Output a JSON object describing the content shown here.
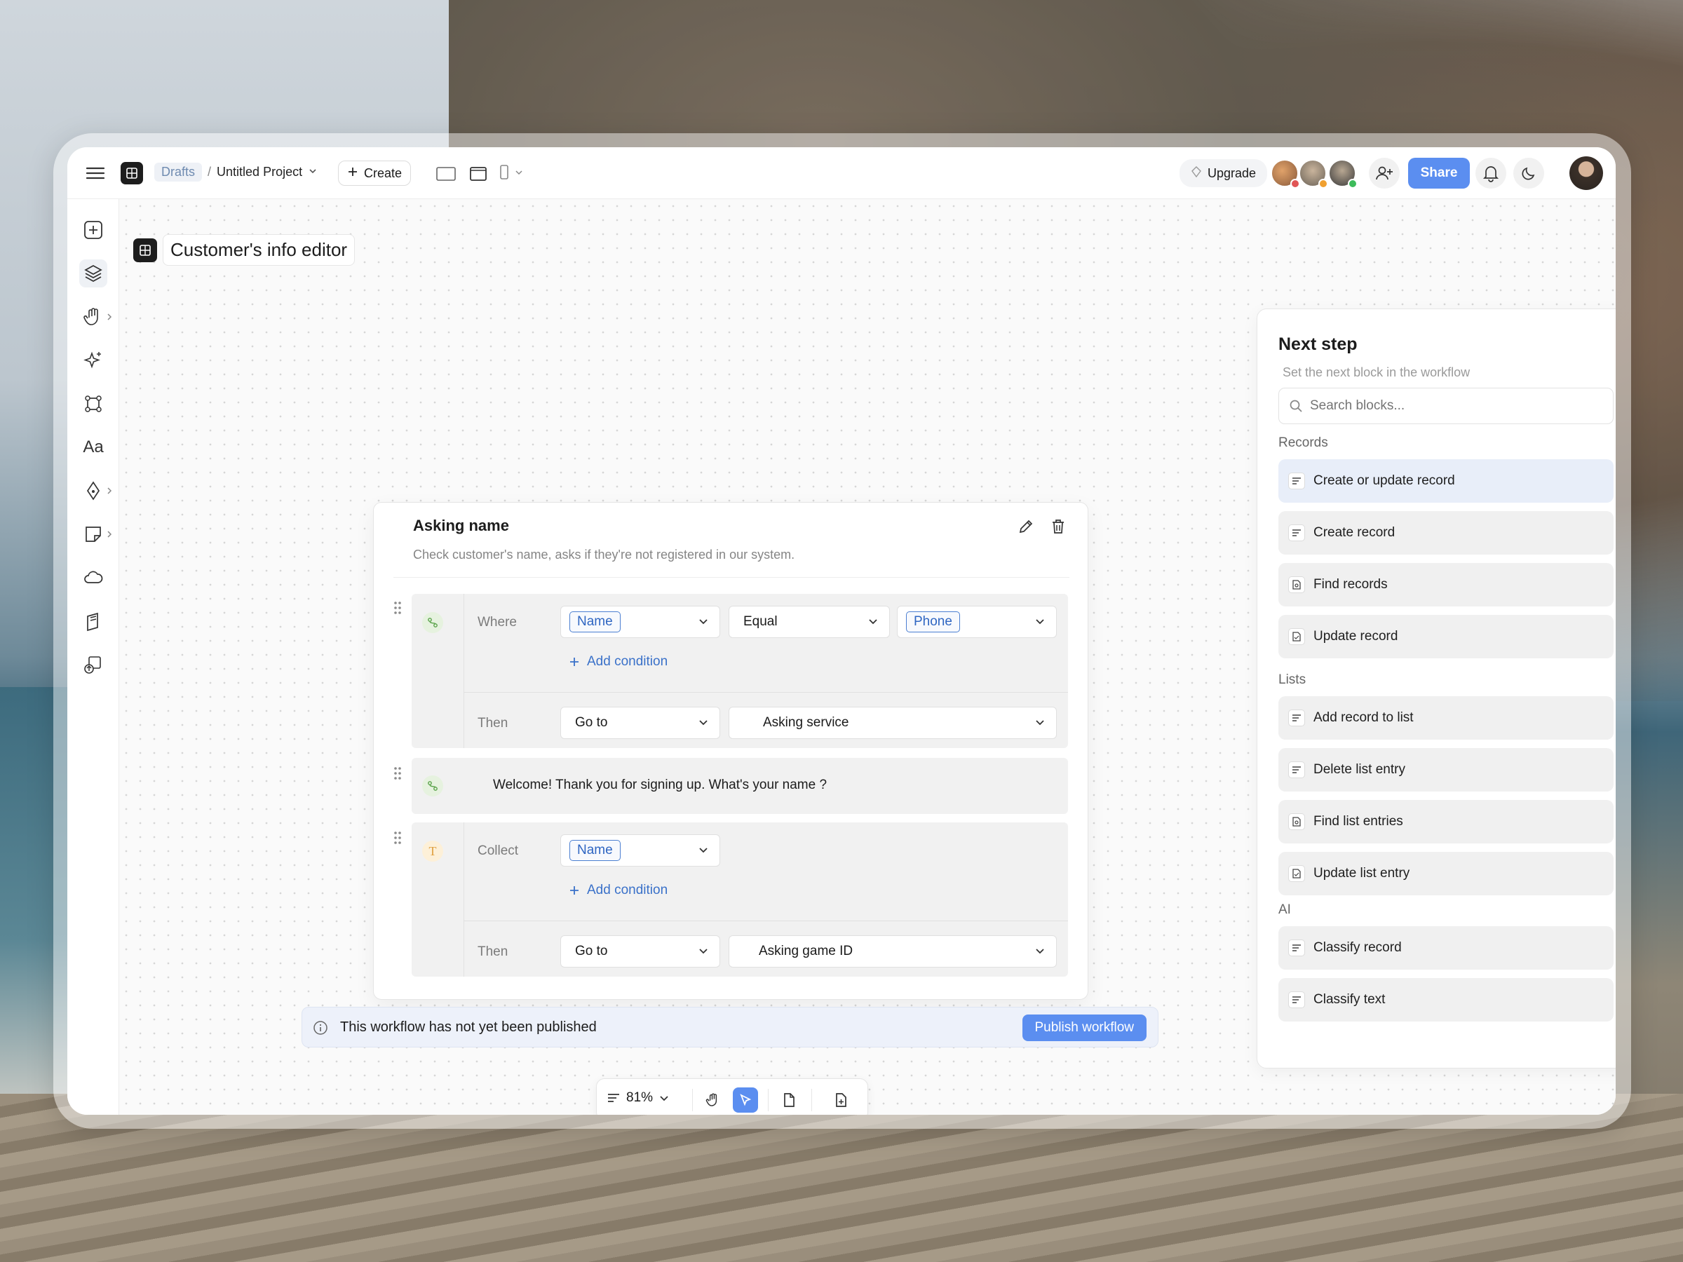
{
  "topbar": {
    "breadcrumb_root": "Drafts",
    "breadcrumb_sep": "/",
    "project_name": "Untitled Project",
    "create_label": "Create",
    "upgrade_label": "Upgrade",
    "share_label": "Share"
  },
  "canvas": {
    "title": "Customer's info editor"
  },
  "card": {
    "title": "Asking name",
    "description": "Check customer's name, asks if they're not registered in our system.",
    "rule1": {
      "where_label": "Where",
      "field": "Name",
      "operator": "Equal",
      "value": "Phone",
      "add_condition": "Add condition",
      "then_label": "Then",
      "action": "Go to",
      "target": "Asking service"
    },
    "message": {
      "text": "Welcome! Thank you for signing up. What's your name ?"
    },
    "rule2": {
      "collect_label": "Collect",
      "field": "Name",
      "add_condition": "Add condition",
      "then_label": "Then",
      "action": "Go to",
      "target": "Asking game ID"
    }
  },
  "banner": {
    "text": "This workflow has not yet been published",
    "publish_label": "Publish workflow"
  },
  "zoom": {
    "value": "81%"
  },
  "panel": {
    "title": "Next step",
    "subtitle": "Set the next block in the workflow",
    "search_placeholder": "Search blocks...",
    "sections": [
      {
        "label": "Records",
        "items": [
          "Create or update record",
          "Create record",
          "Find records",
          "Update record"
        ]
      },
      {
        "label": "Lists",
        "items": [
          "Add record to list",
          "Delete list entry",
          "Find list entries",
          "Update list entry"
        ]
      },
      {
        "label": "AI",
        "items": [
          "Classify record",
          "Classify text"
        ]
      }
    ]
  },
  "colors": {
    "accent": "#5b8ef0",
    "link": "#3a71c9",
    "tag_border": "#4b7fd1",
    "selected_block": "#e8eef9"
  }
}
